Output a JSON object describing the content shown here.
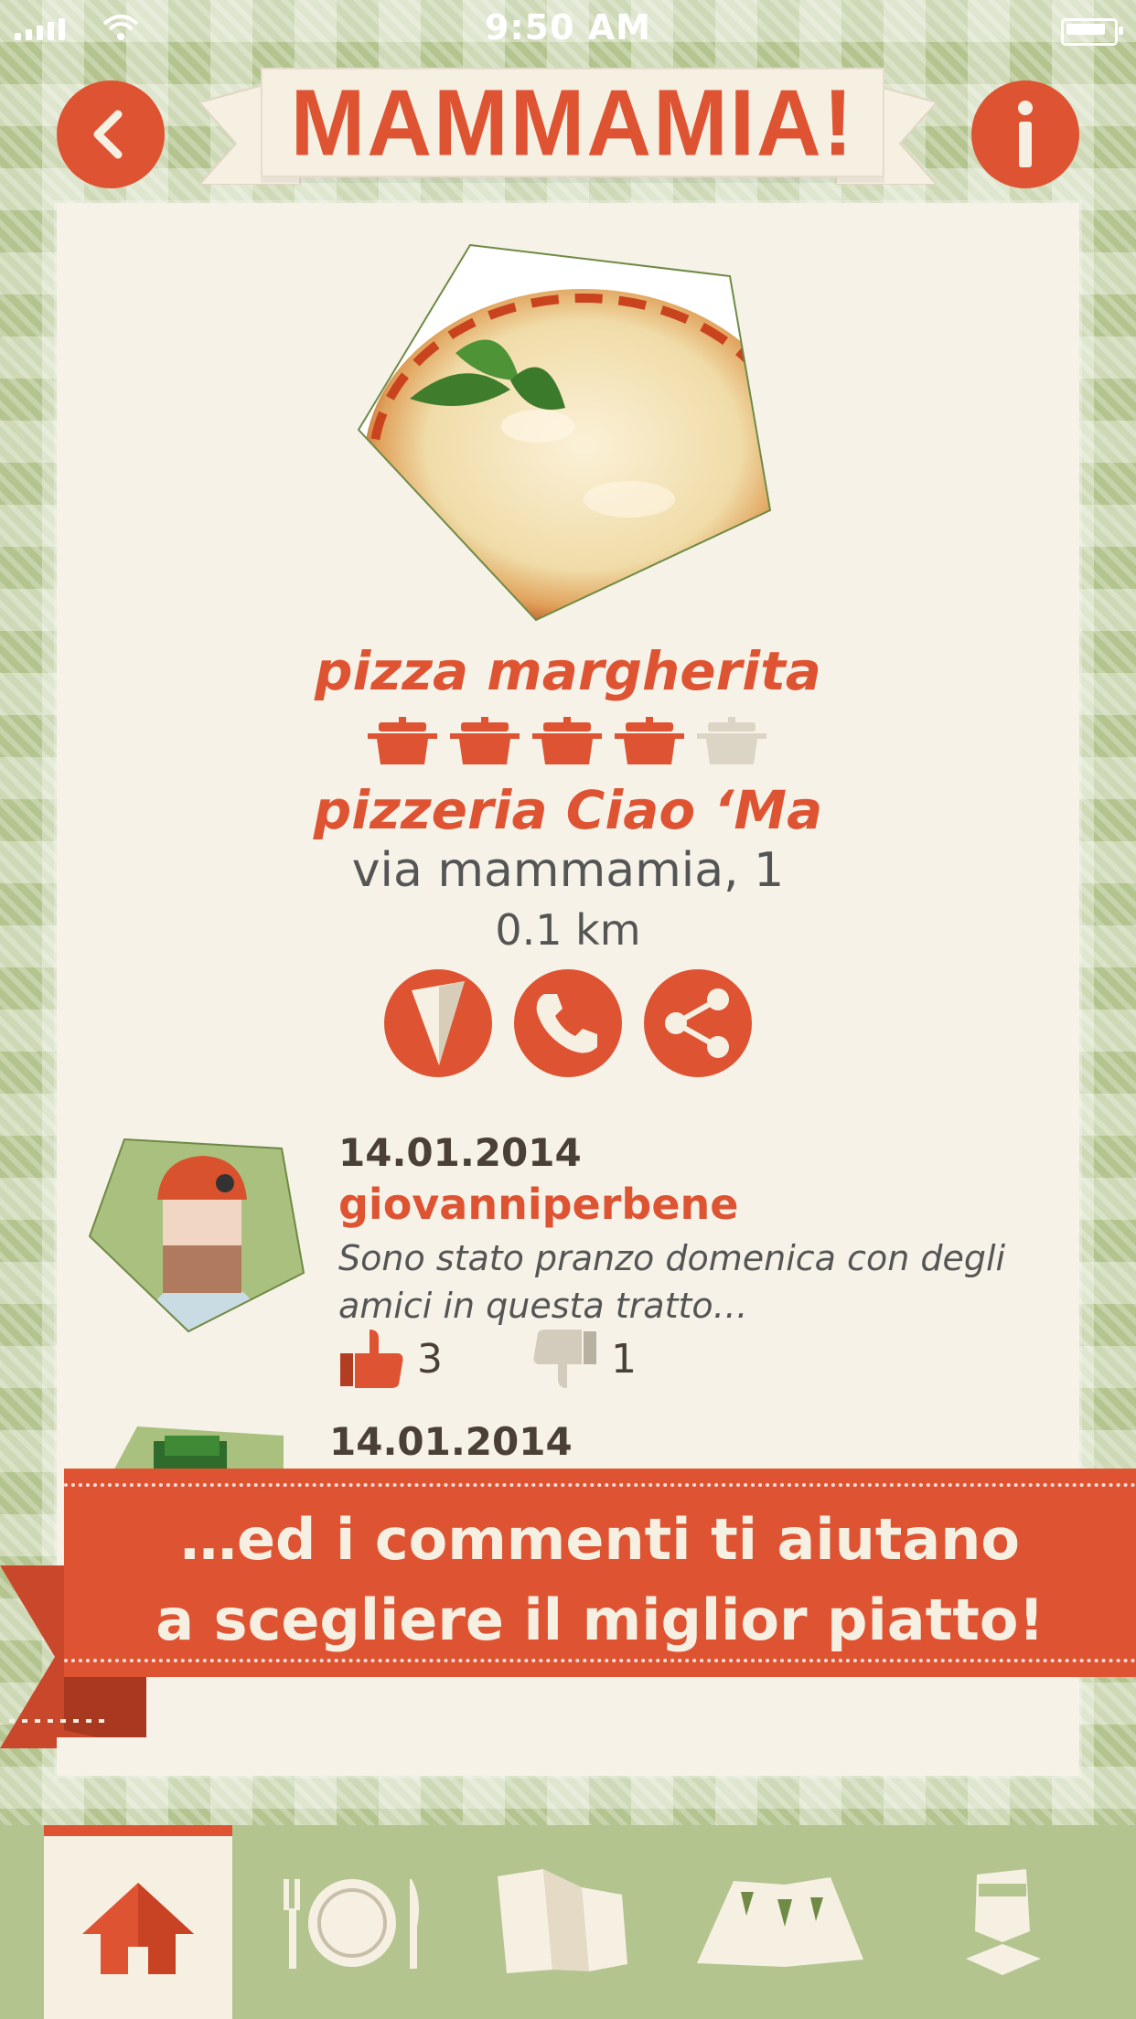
{
  "status_bar": {
    "time": "9:50 AM"
  },
  "header": {
    "title": "MAMMAMIA!",
    "back_icon": "chevron-left-icon",
    "info_icon": "info-icon"
  },
  "dish": {
    "name": "pizza margherita",
    "rating": 4,
    "rating_max": 5,
    "restaurant": "pizzeria Ciao ‘Ma",
    "address": "via mammamia, 1",
    "distance": "0.1 km"
  },
  "actions": [
    {
      "name": "directions",
      "icon": "compass-icon"
    },
    {
      "name": "call",
      "icon": "phone-icon"
    },
    {
      "name": "share",
      "icon": "share-icon"
    }
  ],
  "reviews": [
    {
      "date": "14.01.2014",
      "user": "giovanniperbene",
      "text_line1": "Sono stato pranzo domenica con degli",
      "text_line2": "amici in questa tratto…",
      "likes": "3",
      "dislikes": "1"
    },
    {
      "date": "14.01.2014"
    }
  ],
  "promo": {
    "line1": "…ed i commenti ti aiutano",
    "line2": "a scegliere il miglior piatto!"
  },
  "tabs": [
    {
      "name": "home",
      "icon": "home-icon",
      "active": true
    },
    {
      "name": "dishes",
      "icon": "plate-cutlery-icon",
      "active": false
    },
    {
      "name": "map",
      "icon": "map-icon",
      "active": false
    },
    {
      "name": "places",
      "icon": "places-icon",
      "active": false
    },
    {
      "name": "profile",
      "icon": "user-icon",
      "active": false
    }
  ],
  "colors": {
    "accent": "#de5433",
    "background_green": "#b3c48f",
    "card": "#f6f2e8",
    "text_dark": "#4a4036"
  }
}
